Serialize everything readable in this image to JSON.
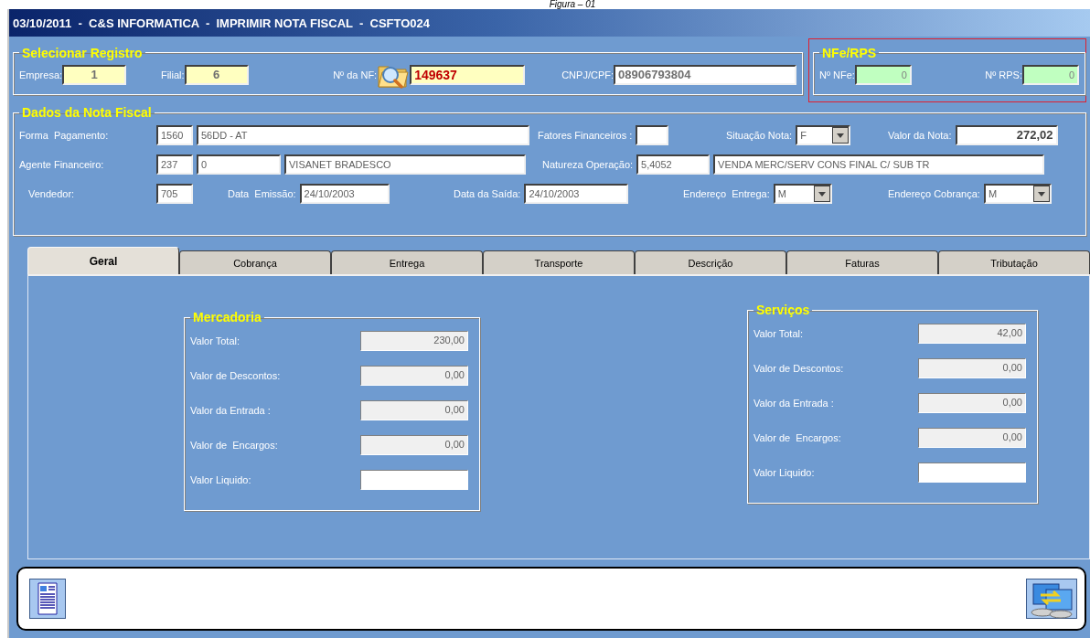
{
  "caption": "Figura – 01",
  "window": {
    "title": "03/10/2011  -  C&S INFORMATICA  -  IMPRIMIR NOTA FISCAL  -  CSFTO024"
  },
  "selecionar": {
    "title": "Selecionar Registro",
    "fields": [
      {
        "label": "Empresa:",
        "value": "1",
        "kind": "key"
      },
      {
        "label": "Filial:",
        "value": "6",
        "kind": "key"
      },
      {
        "label": "Nº da NF:",
        "value": "149637",
        "kind": "search"
      },
      {
        "label": "CNPJ/CPF:",
        "value": "08906793804",
        "kind": "plain"
      }
    ]
  },
  "nfe_rps": {
    "title": "NFe/RPS",
    "highlighted": true,
    "fields": [
      {
        "label": "Nº NFe:",
        "value": "0"
      },
      {
        "label": "Nº RPS:",
        "value": "0"
      }
    ]
  },
  "dados": {
    "title": "Dados da Nota Fiscal",
    "lines": [
      {
        "fields": [
          {
            "label": "Forma  Pagamento:",
            "inputs": [
              {
                "value": "1560",
                "kind": "text"
              },
              {
                "value": "56DD - AT",
                "kind": "text"
              }
            ]
          },
          {
            "label": "Fatores Financeiros :",
            "inputs": [
              {
                "kind": "text"
              }
            ]
          },
          {
            "label": "Situação Nota:",
            "inputs": [
              {
                "value": "F",
                "kind": "combo"
              }
            ]
          },
          {
            "label": "Valor da Nota:",
            "inputs": [
              {
                "value": "272,02",
                "kind": "amount"
              }
            ]
          }
        ]
      },
      {
        "fields": [
          {
            "label": "Agente Financeiro:",
            "inputs": [
              {
                "value": "237",
                "kind": "text"
              },
              {
                "value": "0",
                "kind": "text"
              },
              {
                "value": "VISANET BRADESCO",
                "kind": "text"
              }
            ]
          },
          {
            "label": "Natureza Operação:",
            "inputs": [
              {
                "value": "5,4052",
                "kind": "text"
              },
              {
                "value": "VENDA MERC/SERV CONS FINAL C/ SUB TR",
                "kind": "text"
              }
            ]
          }
        ]
      },
      {
        "fields": [
          {
            "label": "Vendedor:",
            "inputs": [
              {
                "value": "705",
                "kind": "text"
              }
            ]
          },
          {
            "label": "Data  Emissão:",
            "inputs": [
              {
                "value": "24/10/2003",
                "kind": "text"
              }
            ]
          },
          {
            "label": "Data da Saída:",
            "inputs": [
              {
                "value": "24/10/2003",
                "kind": "text"
              }
            ]
          },
          {
            "label": "Endereço  Entrega:",
            "inputs": [
              {
                "value": "M",
                "kind": "combo"
              }
            ]
          },
          {
            "label": "Endereço Cobrança:",
            "inputs": [
              {
                "value": "M",
                "kind": "combo"
              }
            ]
          }
        ]
      }
    ]
  },
  "tabs": [
    {
      "label": "Geral",
      "selected": true
    },
    {
      "label": "Cobrança",
      "selected": false
    },
    {
      "label": "Entrega",
      "selected": false
    },
    {
      "label": "Transporte",
      "selected": false
    },
    {
      "label": "Descrição",
      "selected": false
    },
    {
      "label": "Faturas",
      "selected": false
    },
    {
      "label": "Tributação",
      "selected": false
    }
  ],
  "mercadoria": {
    "title": "Mercadoria",
    "rows": [
      {
        "label": "Valor Total:",
        "value": "230,00"
      },
      {
        "label": "Valor de Descontos:",
        "value": "0,00"
      },
      {
        "label": "Valor da Entrada :",
        "value": "0,00"
      },
      {
        "label": "Valor de  Encargos:",
        "value": "0,00"
      },
      {
        "label": "Valor Liquido:"
      }
    ]
  },
  "servicos": {
    "title": "Serviços",
    "rows": [
      {
        "label": "Valor Total:",
        "value": "42,00"
      },
      {
        "label": "Valor de Descontos:",
        "value": "0,00"
      },
      {
        "label": "Valor da Entrada :",
        "value": "0,00"
      },
      {
        "label": "Valor de  Encargos:",
        "value": "0,00"
      },
      {
        "label": "Valor Liquido:"
      }
    ]
  }
}
